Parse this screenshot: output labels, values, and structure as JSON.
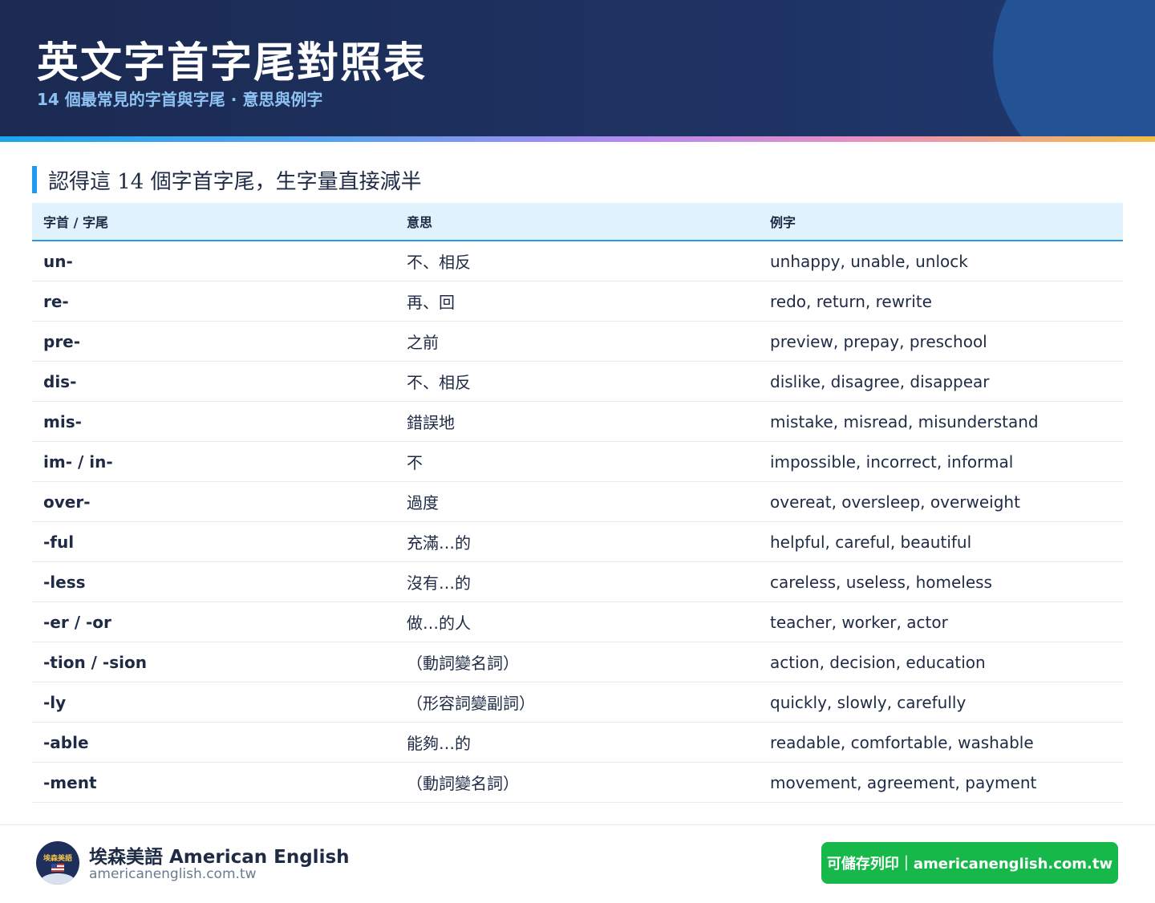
{
  "header": {
    "title": "英文字首字尾對照表",
    "subtitle": "14 個最常見的字首與字尾 · 意思與例字"
  },
  "section": {
    "title": "認得這 14 個字首字尾，生字量直接減半"
  },
  "table": {
    "headers": [
      "字首 / 字尾",
      "意思",
      "例字"
    ],
    "rows": [
      {
        "affix": "un-",
        "meaning": "不、相反",
        "examples": "unhappy, unable, unlock"
      },
      {
        "affix": "re-",
        "meaning": "再、回",
        "examples": "redo, return, rewrite"
      },
      {
        "affix": "pre-",
        "meaning": "之前",
        "examples": "preview, prepay, preschool"
      },
      {
        "affix": "dis-",
        "meaning": "不、相反",
        "examples": "dislike, disagree, disappear"
      },
      {
        "affix": "mis-",
        "meaning": "錯誤地",
        "examples": "mistake, misread, misunderstand"
      },
      {
        "affix": "im- / in-",
        "meaning": "不",
        "examples": "impossible, incorrect, informal"
      },
      {
        "affix": "over-",
        "meaning": "過度",
        "examples": "overeat, oversleep, overweight"
      },
      {
        "affix": "-ful",
        "meaning": "充滿…的",
        "examples": "helpful, careful, beautiful"
      },
      {
        "affix": "-less",
        "meaning": "沒有…的",
        "examples": "careless, useless, homeless"
      },
      {
        "affix": "-er / -or",
        "meaning": "做…的人",
        "examples": "teacher, worker, actor"
      },
      {
        "affix": "-tion / -sion",
        "meaning": "（動詞變名詞）",
        "examples": "action, decision, education"
      },
      {
        "affix": "-ly",
        "meaning": "（形容詞變副詞）",
        "examples": "quickly, slowly, carefully"
      },
      {
        "affix": "-able",
        "meaning": "能夠…的",
        "examples": "readable, comfortable, washable"
      },
      {
        "affix": "-ment",
        "meaning": "（動詞變名詞）",
        "examples": "movement, agreement, payment"
      }
    ]
  },
  "footer": {
    "logo_text": "埃森美語",
    "logo_icon": "us-flag-icon",
    "brand_name": "埃森美語 American English",
    "brand_url": "americanenglish.com.tw",
    "cta_label": "可儲存列印｜americanenglish.com.tw"
  },
  "colors": {
    "header_bg": "#1b2a52",
    "accent_blue": "#1d9bf0",
    "cta_green": "#16b84a",
    "table_header_bg": "#dff2fd"
  }
}
